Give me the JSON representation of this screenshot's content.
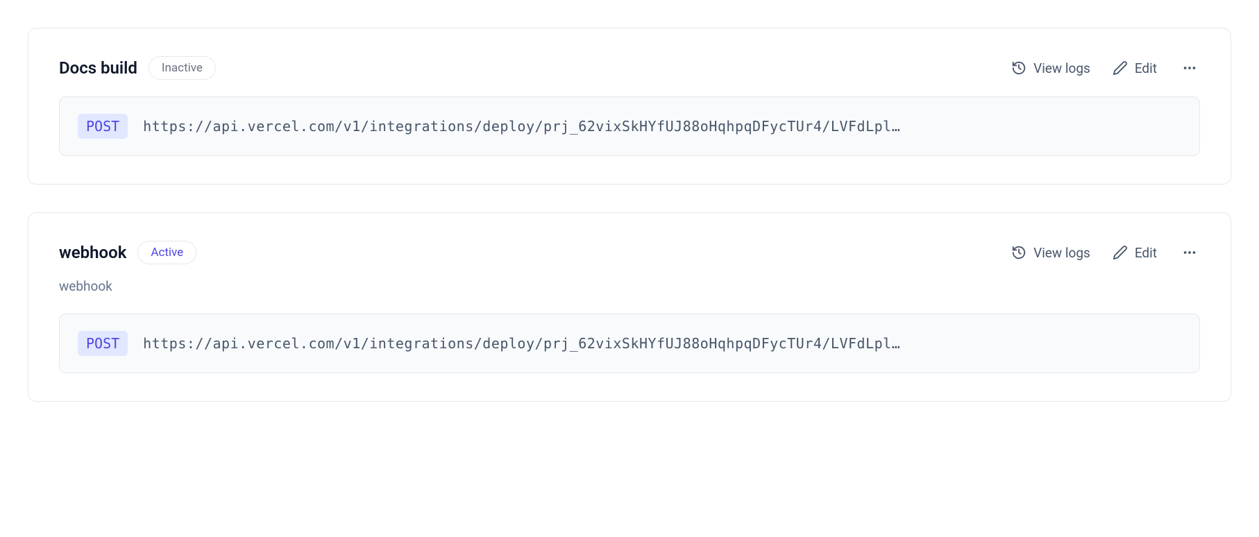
{
  "actions": {
    "view_logs": "View logs",
    "edit": "Edit"
  },
  "items": [
    {
      "title": "Docs build",
      "status_label": "Inactive",
      "status_kind": "inactive",
      "subtitle": null,
      "method": "POST",
      "url": "https://api.vercel.com/v1/integrations/deploy/prj_62vixSkHYfUJ88oHqhpqDFycTUr4/LVFdLpl…"
    },
    {
      "title": "webhook",
      "status_label": "Active",
      "status_kind": "active",
      "subtitle": "webhook",
      "method": "POST",
      "url": "https://api.vercel.com/v1/integrations/deploy/prj_62vixSkHYfUJ88oHqhpqDFycTUr4/LVFdLpl…"
    }
  ]
}
